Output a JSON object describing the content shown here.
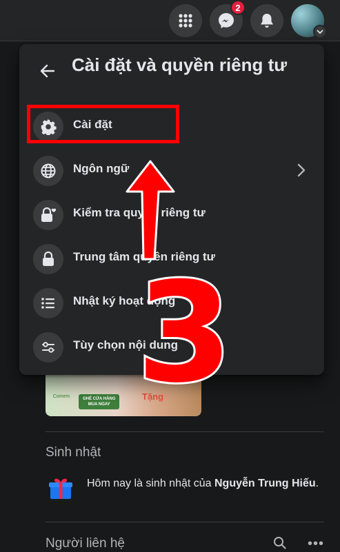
{
  "topbar": {
    "messenger_badge": "2",
    "icons": [
      "menu-grid-icon",
      "messenger-icon",
      "bell-icon",
      "avatar-chevron-icon"
    ]
  },
  "panel": {
    "title": "Cài đặt và quyền riêng tư",
    "items": [
      {
        "label": "Cài đặt",
        "icon": "gear-icon",
        "chevron": false
      },
      {
        "label": "Ngôn ngữ",
        "icon": "globe-icon",
        "chevron": true
      },
      {
        "label": "Kiểm tra quyền riêng tư",
        "icon": "lock-heart-icon",
        "chevron": false
      },
      {
        "label": "Trung tâm quyền riêng tư",
        "icon": "lock-icon",
        "chevron": false
      },
      {
        "label": "Nhật ký hoạt động",
        "icon": "list-icon",
        "chevron": false
      },
      {
        "label": "Tùy chọn nội dung",
        "icon": "sliders-icon",
        "chevron": false
      }
    ]
  },
  "ad": {
    "button_label": "GHÉ CỬA HÀNG\nMUA NGAY",
    "tag_label": "Tặng",
    "brand": "Comem"
  },
  "birthday": {
    "section_title": "Sinh nhật",
    "text_prefix": "Hôm nay là sinh nhật của ",
    "name": "Nguyễn Trung Hiếu",
    "text_suffix": "."
  },
  "contacts": {
    "section_title": "Người liên hệ",
    "more_label": "•••"
  },
  "annotation": {
    "step_number": "3",
    "highlight_color": "#ff0000"
  },
  "colors": {
    "background": "#18191a",
    "surface": "#242526",
    "icon_bg": "#3a3b3c",
    "text": "#e4e6eb",
    "secondary_text": "#b0b3b8",
    "badge": "#e41e3f"
  }
}
